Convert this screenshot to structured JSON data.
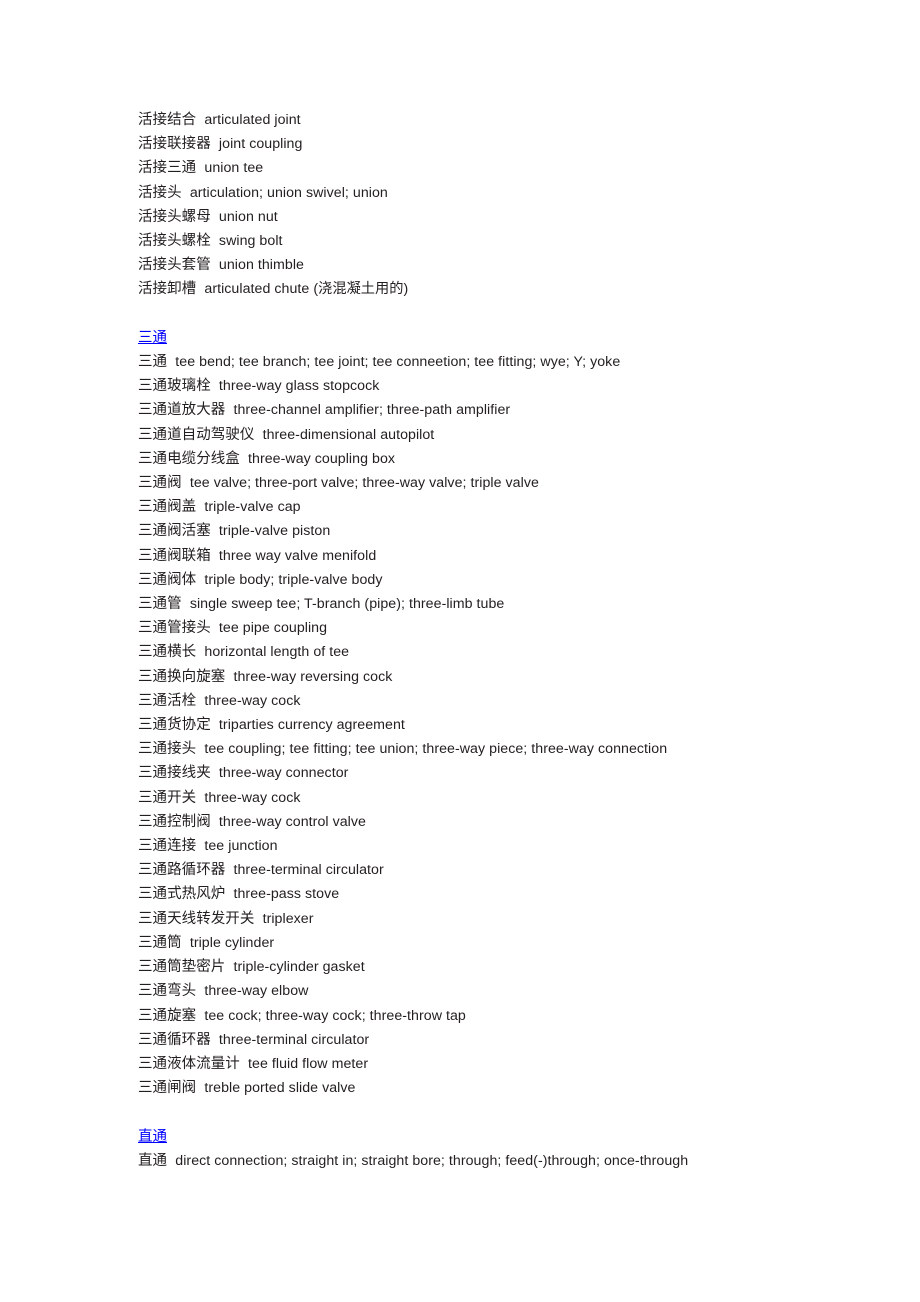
{
  "document": {
    "background_color": "#ffffff",
    "text_color": "#231f20",
    "link_color": "#0000ff"
  },
  "blocks": [
    {
      "kind": "entry",
      "term": "活接结合",
      "gloss": "articulated joint"
    },
    {
      "kind": "entry",
      "term": "活接联接器",
      "gloss": "joint coupling"
    },
    {
      "kind": "entry",
      "term": "活接三通",
      "gloss": "union tee"
    },
    {
      "kind": "entry",
      "term": "活接头",
      "gloss": "articulation; union swivel; union"
    },
    {
      "kind": "entry",
      "term": "活接头螺母",
      "gloss": "union nut"
    },
    {
      "kind": "entry",
      "term": "活接头螺栓",
      "gloss": "swing bolt"
    },
    {
      "kind": "entry",
      "term": "活接头套管",
      "gloss": "union thimble"
    },
    {
      "kind": "entry",
      "term": "活接卸槽",
      "gloss": "articulated chute (浇混凝土用的)"
    },
    {
      "kind": "spacer"
    },
    {
      "kind": "heading",
      "label": "三通 "
    },
    {
      "kind": "entry",
      "term": "三通",
      "gloss": "tee bend; tee branch; tee joint; tee conneetion; tee fitting; wye; Y; yoke"
    },
    {
      "kind": "entry",
      "term": "三通玻璃栓",
      "gloss": "three-way glass stopcock"
    },
    {
      "kind": "entry",
      "term": "三通道放大器",
      "gloss": "three-channel amplifier; three-path amplifier"
    },
    {
      "kind": "entry",
      "term": "三通道自动驾驶仪",
      "gloss": "three-dimensional autopilot"
    },
    {
      "kind": "entry",
      "term": "三通电缆分线盒",
      "gloss": "three-way coupling box"
    },
    {
      "kind": "entry",
      "term": "三通阀",
      "gloss": "tee valve; three-port valve; three-way valve; triple valve"
    },
    {
      "kind": "entry",
      "term": "三通阀盖",
      "gloss": "triple-valve cap"
    },
    {
      "kind": "entry",
      "term": "三通阀活塞",
      "gloss": "triple-valve piston"
    },
    {
      "kind": "entry",
      "term": "三通阀联箱",
      "gloss": "three way valve menifold"
    },
    {
      "kind": "entry",
      "term": "三通阀体",
      "gloss": "triple body; triple-valve body"
    },
    {
      "kind": "entry",
      "term": "三通管",
      "gloss": "single sweep tee; T-branch (pipe); three-limb tube"
    },
    {
      "kind": "entry",
      "term": "三通管接头",
      "gloss": "tee pipe coupling"
    },
    {
      "kind": "entry",
      "term": "三通横长",
      "gloss": "horizontal length of tee"
    },
    {
      "kind": "entry",
      "term": "三通换向旋塞",
      "gloss": "three-way reversing cock"
    },
    {
      "kind": "entry",
      "term": "三通活栓",
      "gloss": "three-way cock"
    },
    {
      "kind": "entry",
      "term": "三通货协定",
      "gloss": "triparties currency agreement"
    },
    {
      "kind": "entry",
      "term": "三通接头",
      "gloss": "tee coupling; tee fitting; tee union; three-way piece; three-way connection"
    },
    {
      "kind": "entry",
      "term": "三通接线夹",
      "gloss": "three-way connector"
    },
    {
      "kind": "entry",
      "term": "三通开关",
      "gloss": "three-way cock"
    },
    {
      "kind": "entry",
      "term": "三通控制阀",
      "gloss": "three-way control valve"
    },
    {
      "kind": "entry",
      "term": "三通连接",
      "gloss": "tee junction"
    },
    {
      "kind": "entry",
      "term": "三通路循环器",
      "gloss": "three-terminal circulator"
    },
    {
      "kind": "entry",
      "term": "三通式热风炉",
      "gloss": "three-pass stove"
    },
    {
      "kind": "entry",
      "term": "三通天线转发开关",
      "gloss": "triplexer"
    },
    {
      "kind": "entry",
      "term": "三通筒",
      "gloss": "triple cylinder"
    },
    {
      "kind": "entry",
      "term": "三通筒垫密片",
      "gloss": "triple-cylinder gasket"
    },
    {
      "kind": "entry",
      "term": "三通弯头",
      "gloss": "three-way elbow"
    },
    {
      "kind": "entry",
      "term": "三通旋塞",
      "gloss": "tee cock; three-way cock; three-throw tap"
    },
    {
      "kind": "entry",
      "term": "三通循环器",
      "gloss": "three-terminal circulator"
    },
    {
      "kind": "entry",
      "term": "三通液体流量计",
      "gloss": "tee fluid flow meter"
    },
    {
      "kind": "entry",
      "term": "三通闸阀",
      "gloss": "treble ported slide valve"
    },
    {
      "kind": "spacer"
    },
    {
      "kind": "heading",
      "label": "直通 "
    },
    {
      "kind": "entry",
      "term": "直通",
      "gloss": "direct connection; straight in; straight bore; through; feed(-)through; once-through"
    }
  ]
}
